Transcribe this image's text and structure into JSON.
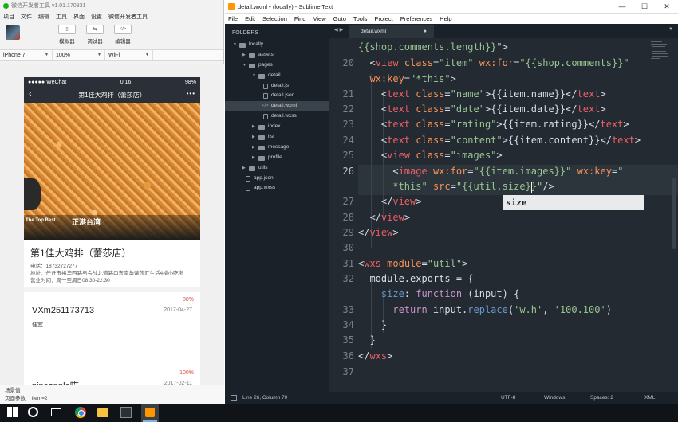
{
  "devtools": {
    "title": "微信开发者工具 v1.01.170831",
    "menu": [
      "项目",
      "文件",
      "编辑",
      "工具",
      "界面",
      "设置",
      "微信开发者工具"
    ],
    "tools": [
      {
        "label": "模拟器",
        "icon": "phone-icon"
      },
      {
        "label": "调试器",
        "icon": "debug-icon"
      },
      {
        "label": "编辑器",
        "icon": "code-icon"
      }
    ],
    "device": "iPhone 7",
    "zoom": "100%",
    "network": "WiFi",
    "footer": {
      "scene_label": "场景值",
      "params_label": "页面参数",
      "params_value": "item=2"
    }
  },
  "phone": {
    "carrier": "●●●●● WeChat",
    "time": "0:16",
    "battery": "98%",
    "nav_title": "第1佳大鸡排（蕾莎店）",
    "hero_sign": {
      "left": "The Top Best",
      "right": "正港台湾"
    },
    "shop": {
      "name": "第1佳大鸡排（蕾莎店）",
      "phone": "电话：18732727277",
      "address": "地址：任丘市裕华西路与会战北道路口东南角蕾莎汇生活4楼小吃街",
      "hours": "营业时间：周一至周日08:30-22:30"
    },
    "comments": [
      {
        "name": "VXm251173713",
        "date": "2017-04-27",
        "rating": "80%",
        "content": "便宜"
      },
      {
        "name": "pineapple喵",
        "date": "2017-02-11",
        "rating": "100%",
        "content": ""
      }
    ]
  },
  "sublime": {
    "title": "detail.wxml • (locally) - Sublime Text",
    "window_buttons": [
      "—",
      "☐",
      "✕"
    ],
    "menu": [
      "File",
      "Edit",
      "Selection",
      "Find",
      "View",
      "Goto",
      "Tools",
      "Project",
      "Preferences",
      "Help"
    ],
    "folders_header": "FOLDERS",
    "tree": [
      {
        "label": "locally",
        "type": "folder-open"
      },
      {
        "label": "assets",
        "type": "folder"
      },
      {
        "label": "pages",
        "type": "folder-open"
      },
      {
        "label": "detail",
        "type": "folder-open"
      },
      {
        "label": "detail.js",
        "type": "file"
      },
      {
        "label": "detail.json",
        "type": "file"
      },
      {
        "label": "detail.wxml",
        "type": "file-code",
        "selected": true
      },
      {
        "label": "detail.wxss",
        "type": "file"
      },
      {
        "label": "index",
        "type": "folder"
      },
      {
        "label": "list",
        "type": "folder"
      },
      {
        "label": "message",
        "type": "folder"
      },
      {
        "label": "profile",
        "type": "folder"
      },
      {
        "label": "utils",
        "type": "folder"
      },
      {
        "label": "app.json",
        "type": "file"
      },
      {
        "label": "app.wxss",
        "type": "file"
      }
    ],
    "tab": {
      "label": "detail.wxml",
      "modified": "●"
    },
    "line_numbers": [
      "20",
      "21",
      "22",
      "23",
      "24",
      "25",
      "26",
      "27",
      "28",
      "29",
      "30",
      "31",
      "32",
      "33",
      "34",
      "35",
      "36",
      "37"
    ],
    "autocomplete": "size",
    "status": {
      "position": "Line 26, Column 70",
      "encoding": "UTF-8",
      "line_endings": "Windows",
      "indent": "Spaces: 2",
      "syntax": "XML"
    }
  }
}
